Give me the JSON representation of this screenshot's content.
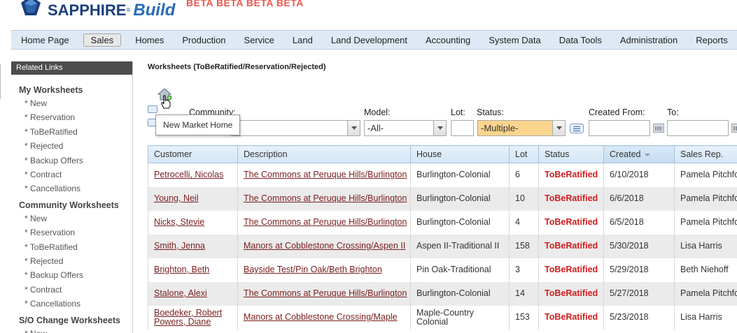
{
  "app": {
    "logo_text": "SAPPHIRE",
    "logo_build": "Build",
    "beta": "BETA BETA BETA BETA",
    "brand_color": "#1b3f7d"
  },
  "nav": {
    "items": [
      "Home Page",
      "Sales",
      "Homes",
      "Production",
      "Service",
      "Land",
      "Land Development",
      "Accounting",
      "System Data",
      "Data Tools",
      "Administration",
      "Reports"
    ],
    "active": "Sales"
  },
  "sidebar": {
    "header": "Related Links",
    "sections": [
      {
        "title": "My Worksheets",
        "links": [
          "* New",
          "* Reservation",
          "* ToBeRatified",
          "* Rejected",
          "* Backup Offers",
          "* Contract",
          "* Cancellations"
        ]
      },
      {
        "title": "Community Worksheets",
        "links": [
          "* New",
          "* Reservation",
          "* ToBeRatified",
          "* Rejected",
          "* Backup Offers",
          "* Contract",
          "* Cancellations"
        ]
      },
      {
        "title": "S/O Change Worksheets",
        "links": [
          "* New"
        ]
      }
    ]
  },
  "page": {
    "title": "Worksheets (ToBeRatified/Reservation/Rejected)",
    "tooltip": "New Market Home",
    "home_icon": "house-add-icon"
  },
  "filters": {
    "community_label": "Community:",
    "community_value": "",
    "model_label": "Model:",
    "model_value": "-All-",
    "lot_label": "Lot:",
    "lot_value": "",
    "status_label": "Status:",
    "status_value": "-Multiple-",
    "status_color": "#fbd58e",
    "created_from_label": "Created From:",
    "to_label": "To:"
  },
  "table": {
    "columns": [
      "Customer",
      "Description",
      "House",
      "Lot",
      "Status",
      "Created",
      "Sales Rep."
    ],
    "sorted_column": "Created",
    "status_color": "#d11d1d",
    "rows": [
      {
        "customer": "Petrocelli, Nicolas",
        "customer2": "",
        "description": "The Commons at Peruque Hills/Burlington",
        "house": "Burlington-Colonial",
        "lot": "6",
        "status": "ToBeRatified",
        "created": "6/10/2018",
        "rep": "Pamela Pitchford"
      },
      {
        "customer": "Young, Neil",
        "customer2": "",
        "description": "The Commons at Peruque Hills/Burlington",
        "house": "Burlington-Colonial",
        "lot": "10",
        "status": "ToBeRatified",
        "created": "6/6/2018",
        "rep": "Pamela Pitchford"
      },
      {
        "customer": "Nicks, Stevie",
        "customer2": "",
        "description": "The Commons at Peruque Hills/Burlington",
        "house": "Burlington-Colonial",
        "lot": "4",
        "status": "ToBeRatified",
        "created": "6/5/2018",
        "rep": "Pamela Pitchford"
      },
      {
        "customer": "Smith, Jenna",
        "customer2": "",
        "description": "Manors at Cobblestone Crossing/Aspen II",
        "house": "Aspen II-Traditional II",
        "lot": "158",
        "status": "ToBeRatified",
        "created": "5/30/2018",
        "rep": "Lisa Harris"
      },
      {
        "customer": "Brighton, Beth",
        "customer2": "",
        "description": "Bayside Test/Pin Oak/Beth Brighton",
        "house": "Pin Oak-Traditional",
        "lot": "3",
        "status": "ToBeRatified",
        "created": "5/29/2018",
        "rep": "Beth Niehoff"
      },
      {
        "customer": "Stalone, Alexi",
        "customer2": "",
        "description": "The Commons at Peruque Hills/Burlington",
        "house": "Burlington-Colonial",
        "lot": "14",
        "status": "ToBeRatified",
        "created": "5/27/2018",
        "rep": "Pamela Pitchford"
      },
      {
        "customer": "Boedeker, Robert",
        "customer2": "Powers, Diane",
        "description": "Manors at Cobblestone Crossing/Maple",
        "house": "Maple-Country Colonial",
        "lot": "153",
        "status": "ToBeRatified",
        "created": "5/23/2018",
        "rep": "Lisa Harris"
      }
    ]
  }
}
